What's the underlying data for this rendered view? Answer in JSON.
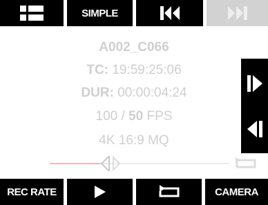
{
  "top_bar": {
    "simple_label": "SIMPLE",
    "icons": [
      "menu-icon",
      "skip-to-start-icon",
      "skip-to-end-icon"
    ]
  },
  "clip_info": {
    "clip_name": "A002_C066",
    "tc_label": "TC:",
    "tc_value": "19:59:25:06",
    "dur_label": "DUR:",
    "dur_value": "00:00:04:24",
    "fps_base": "100 /",
    "fps_project": "50",
    "fps_unit": "FPS",
    "format": "4K 16:9 MQ"
  },
  "playback": {
    "position_fraction": 0.29
  },
  "side_controls": {
    "icons": [
      "step-forward-icon",
      "step-back-icon"
    ]
  },
  "bottom_bar": {
    "rec_rate_label": "REC RATE",
    "camera_label": "CAMERA",
    "icons": [
      "play-icon",
      "loop-icon"
    ]
  },
  "colors": {
    "button_bg": "#000000",
    "disabled_bg": "#d2d2d2",
    "info_text": "#cfcfcf",
    "playhead_trail": "#f2b8b8"
  }
}
